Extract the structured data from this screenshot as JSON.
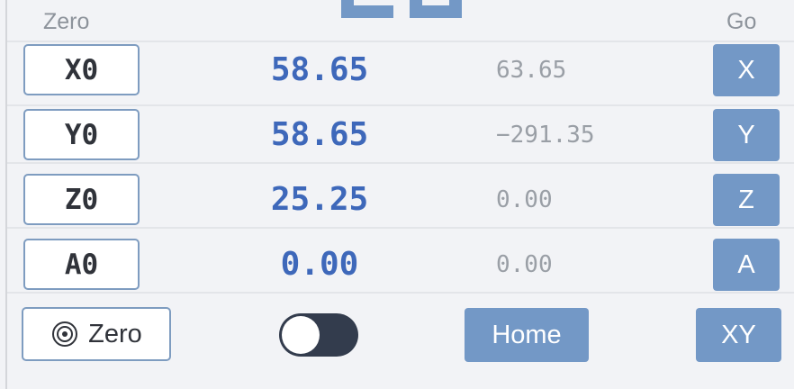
{
  "headers": {
    "zero": "Zero",
    "go": "Go"
  },
  "axes": [
    {
      "zero_label": "X0",
      "work_pos": "58.65",
      "machine_pos": "63.65",
      "go_label": "X"
    },
    {
      "zero_label": "Y0",
      "work_pos": "58.65",
      "machine_pos": "−291.35",
      "go_label": "Y"
    },
    {
      "zero_label": "Z0",
      "work_pos": "25.25",
      "machine_pos": "0.00",
      "go_label": "Z"
    },
    {
      "zero_label": "A0",
      "work_pos": "0.00",
      "machine_pos": "0.00",
      "go_label": "A"
    }
  ],
  "controls": {
    "zero_all_label": "Zero",
    "toggle_on": false,
    "home_label": "Home",
    "go_xy_label": "XY"
  },
  "colors": {
    "accent": "#7398c6",
    "position_text": "#3e68ba",
    "toggle_track": "#333c4d"
  },
  "icons": {
    "zero_all": "target-icon"
  }
}
